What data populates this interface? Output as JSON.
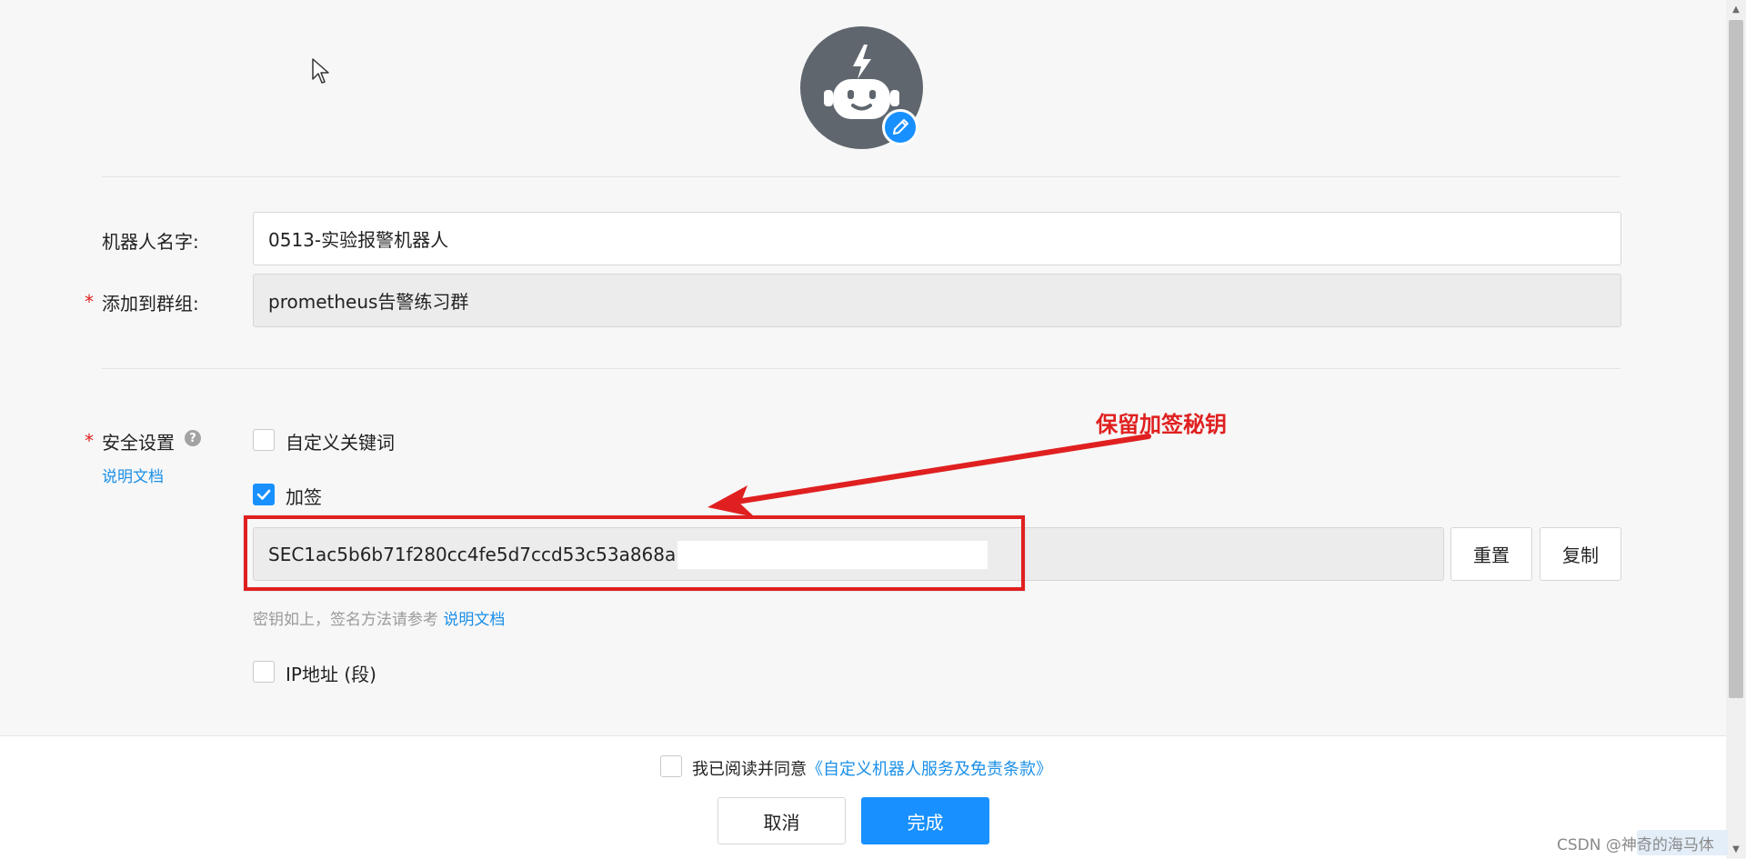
{
  "form": {
    "robot_name_label": "机器人名字:",
    "robot_name_value": "0513-实验报警机器人",
    "group_label": "添加到群组:",
    "group_value": "prometheus告警练习群",
    "required_mark": "*",
    "security_label": "安全设置",
    "security_doc_link": "说明文档",
    "keyword_label": "自定义关键词",
    "keyword_checked": false,
    "sign_label": "加签",
    "sign_checked": true,
    "secret_value": "SEC1ac5b6b71f280cc4fe5d7ccd53c53a868a1l",
    "reset_button": "重置",
    "copy_button": "复制",
    "secret_hint": "密钥如上，签名方法请参考",
    "secret_hint_link": "说明文档",
    "ip_label": "IP地址 (段)",
    "ip_checked": false
  },
  "annotation": {
    "text": "保留加签秘钥",
    "color": "#e02020"
  },
  "footer": {
    "agree_prefix": "我已阅读并同意",
    "agree_link": "《自定义机器人服务及免责条款》",
    "agree_checked": false,
    "cancel_button": "取消",
    "done_button": "完成"
  },
  "watermark": "CSDN @神奇的海马体",
  "colors": {
    "accent": "#1890ff",
    "required": "#e02020",
    "avatar_bg": "#5f666d"
  },
  "icons": {
    "avatar": "robot-icon",
    "edit": "pencil-icon",
    "help": "question-icon",
    "check": "checkmark-icon"
  }
}
